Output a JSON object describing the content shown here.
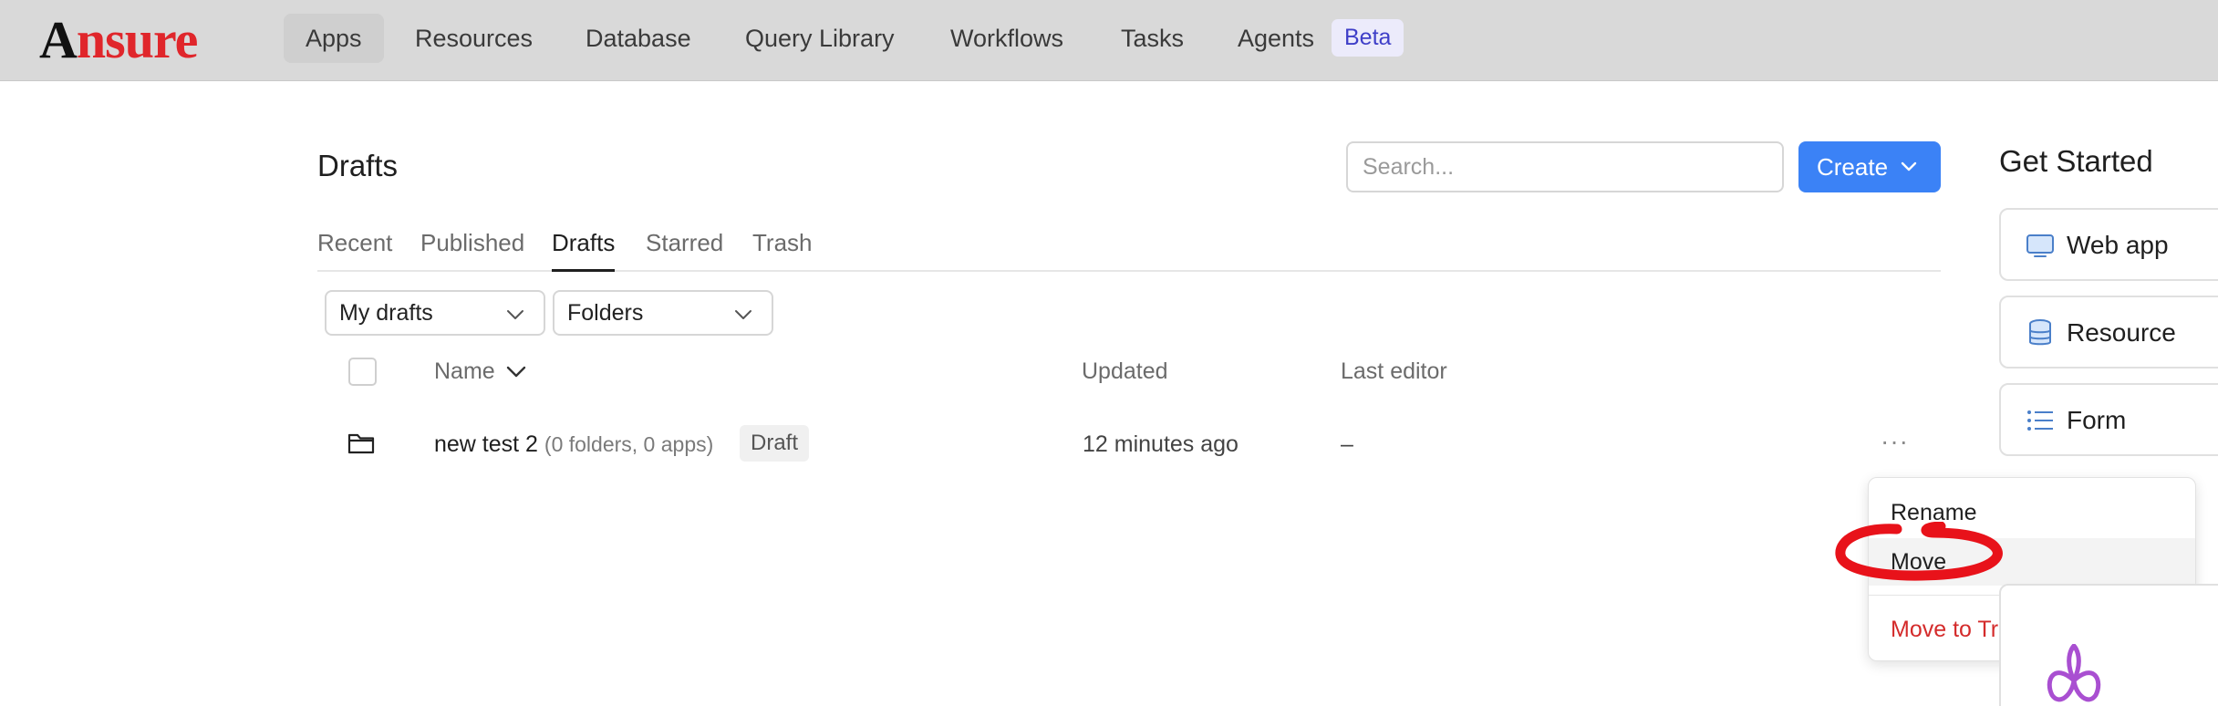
{
  "brand": {
    "logo_first": "A",
    "logo_rest": "nsure"
  },
  "nav": {
    "items": [
      "Apps",
      "Resources",
      "Database",
      "Query Library",
      "Workflows",
      "Tasks",
      "Agents"
    ],
    "active": "Apps",
    "beta_badge": "Beta"
  },
  "main": {
    "title": "Drafts",
    "search_placeholder": "Search...",
    "create_label": "Create",
    "tabs": [
      "Recent",
      "Published",
      "Drafts",
      "Starred",
      "Trash"
    ],
    "active_tab": "Drafts",
    "filters": {
      "owner": "My drafts",
      "view": "Folders"
    },
    "columns": {
      "name": "Name",
      "updated": "Updated",
      "last_editor": "Last editor"
    },
    "rows": [
      {
        "name": "new test 2",
        "meta": "(0 folders, 0 apps)",
        "badge": "Draft",
        "updated": "12 minutes ago",
        "last_editor": "–"
      }
    ],
    "row_actions": "···"
  },
  "context_menu": {
    "items": [
      "Rename",
      "Move",
      "Move to Trash"
    ],
    "highlighted": "Move",
    "danger_color": "#d42b2b"
  },
  "get_started": {
    "title": "Get Started",
    "cards": [
      {
        "label": "Web app",
        "icon": "monitor-icon"
      },
      {
        "label": "Resource",
        "icon": "database-icon"
      },
      {
        "label": "Form",
        "icon": "list-icon"
      }
    ]
  },
  "colors": {
    "accent": "#3b82f6",
    "brand_red": "#e0262b",
    "annotation_red": "#e8121a"
  }
}
